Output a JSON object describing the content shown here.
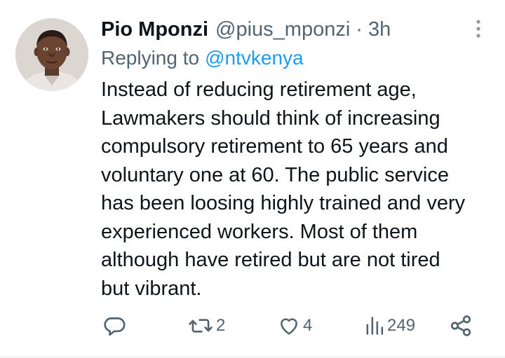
{
  "tweet": {
    "author_name": "Pio Mponzi",
    "author_handle": "@pius_mponzi",
    "separator": "·",
    "time": "3h",
    "replying_label": "Replying to",
    "replying_to": "@ntvkenya",
    "text": "Instead of reducing retirement age,\nLawmakers should think of increasing\ncompulsory retirement to 65 years and\nvoluntary one at 60. The public service\nhas been loosing highly trained and very\nexperienced workers. Most of them\nalthough have retired but are not tired\nbut vibrant."
  },
  "actions": {
    "reply_icon": "reply-icon",
    "retweet_icon": "retweet-icon",
    "retweet_count": "2",
    "like_icon": "heart-icon",
    "like_count": "4",
    "views_icon": "views-icon",
    "views_count": "249",
    "share_icon": "share-icon"
  },
  "colors": {
    "text_primary": "#0f1419",
    "text_secondary": "#536471",
    "accent": "#1d9bf0"
  }
}
